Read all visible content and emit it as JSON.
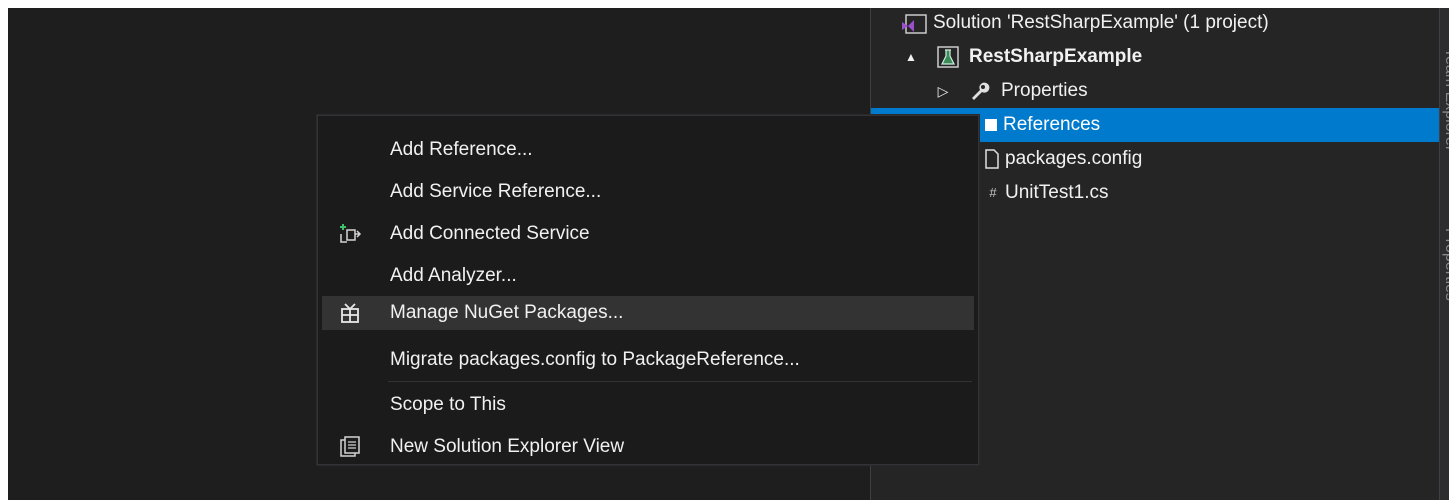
{
  "solution_explorer": {
    "items": [
      {
        "label": "Solution 'RestSharpExample' (1 project)",
        "icon": "solution-icon",
        "bold": false
      },
      {
        "label": "RestSharpExample",
        "icon": "test-project-icon",
        "bold": true,
        "expand": "▲"
      },
      {
        "label": "Properties",
        "icon": "wrench-icon",
        "expand": "▷"
      },
      {
        "label": "References",
        "icon": "references-icon",
        "selected": true
      },
      {
        "label": "packages.config",
        "icon": "file-icon"
      },
      {
        "label": "UnitTest1.cs",
        "icon": "csharp-file-icon",
        "prefix": "#"
      }
    ]
  },
  "side_tabs": [
    "Team Explorer",
    "Properties"
  ],
  "context_menu": {
    "items": [
      {
        "label": "Add Reference..."
      },
      {
        "label": "Add Service Reference..."
      },
      {
        "label": "Add Connected Service",
        "icon": "connected-service-icon"
      },
      {
        "label": "Add Analyzer..."
      },
      {
        "label": "Manage NuGet Packages...",
        "icon": "nuget-package-icon",
        "highlighted": true
      },
      {
        "label": "Migrate packages.config to PackageReference..."
      },
      {
        "label": "Scope to This"
      },
      {
        "label": "New Solution Explorer View",
        "icon": "new-explorer-view-icon"
      }
    ]
  },
  "colors": {
    "background": "#1e1e1e",
    "menu_background": "#1b1b1c",
    "selection": "#007acc",
    "highlight": "#333334",
    "text": "#f1f1f1"
  }
}
